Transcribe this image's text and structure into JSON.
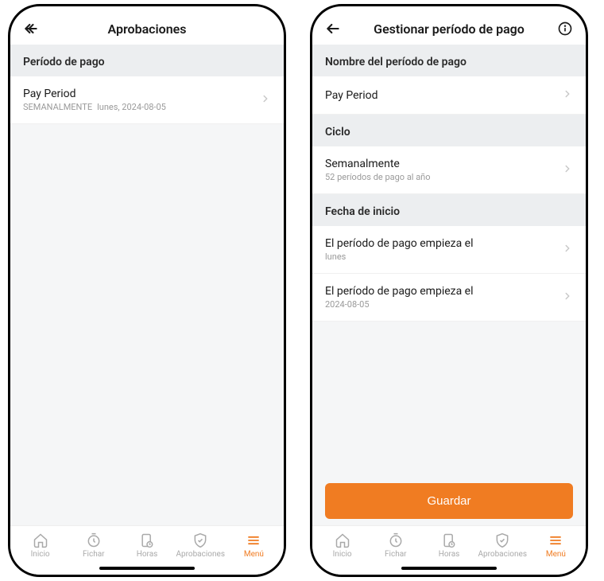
{
  "colors": {
    "accent": "#f07c22"
  },
  "tabs": {
    "home": "Inicio",
    "clock": "Fichar",
    "hours": "Horas",
    "approvals": "Aprobaciones",
    "menu": "Menú"
  },
  "left": {
    "title": "Aprobaciones",
    "section_pay_period": "Período de pago",
    "item": {
      "title": "Pay Period",
      "badge": "SEMANALMENTE",
      "detail": "lunes, 2024-08-05"
    }
  },
  "right": {
    "title": "Gestionar período de pago",
    "section_name": "Nombre del período de pago",
    "name_value": "Pay Period",
    "section_cycle": "Ciclo",
    "cycle": {
      "title": "Semanalmente",
      "sub": "52 períodos de pago al año"
    },
    "section_start": "Fecha de inicio",
    "start_day": {
      "title": "El período de pago empieza el",
      "sub": "lunes"
    },
    "start_date": {
      "title": "El período de pago empieza el",
      "sub": "2024-08-05"
    },
    "save": "Guardar"
  }
}
